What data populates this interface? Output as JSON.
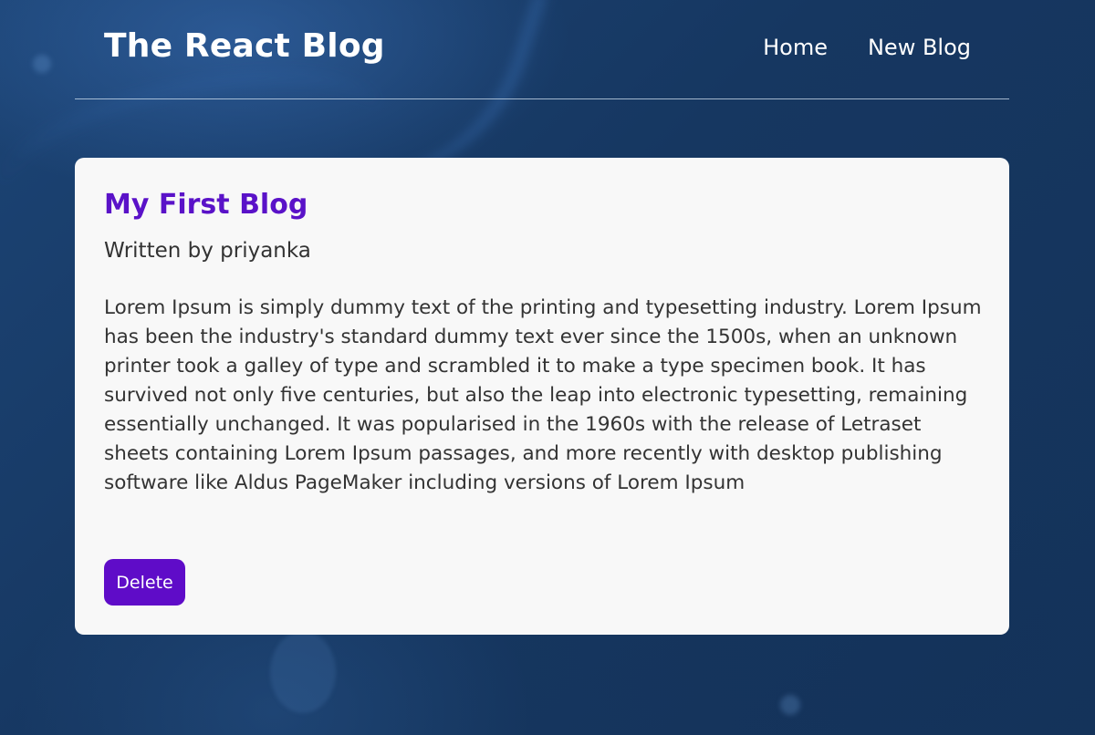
{
  "header": {
    "title": "The React Blog",
    "nav": {
      "home": "Home",
      "new_blog": "New Blog"
    }
  },
  "blog": {
    "title": "My First Blog",
    "author_line": "Written by priyanka",
    "body": "Lorem Ipsum is simply dummy text of the printing and typesetting industry. Lorem Ipsum has been the industry's standard dummy text ever since the 1500s, when an unknown printer took a galley of type and scrambled it to make a type specimen book. It has survived not only five centuries, but also the leap into electronic typesetting, remaining essentially unchanged. It was popularised in the 1960s with the release of Letraset sheets containing Lorem Ipsum passages, and more recently with desktop publishing software like Aldus PageMaker including versions of Lorem Ipsum",
    "delete_label": "Delete"
  },
  "colors": {
    "accent": "#5f0cc8",
    "title": "#5a12c8",
    "card_bg": "#f8f8f8",
    "page_bg": "#17375f"
  }
}
